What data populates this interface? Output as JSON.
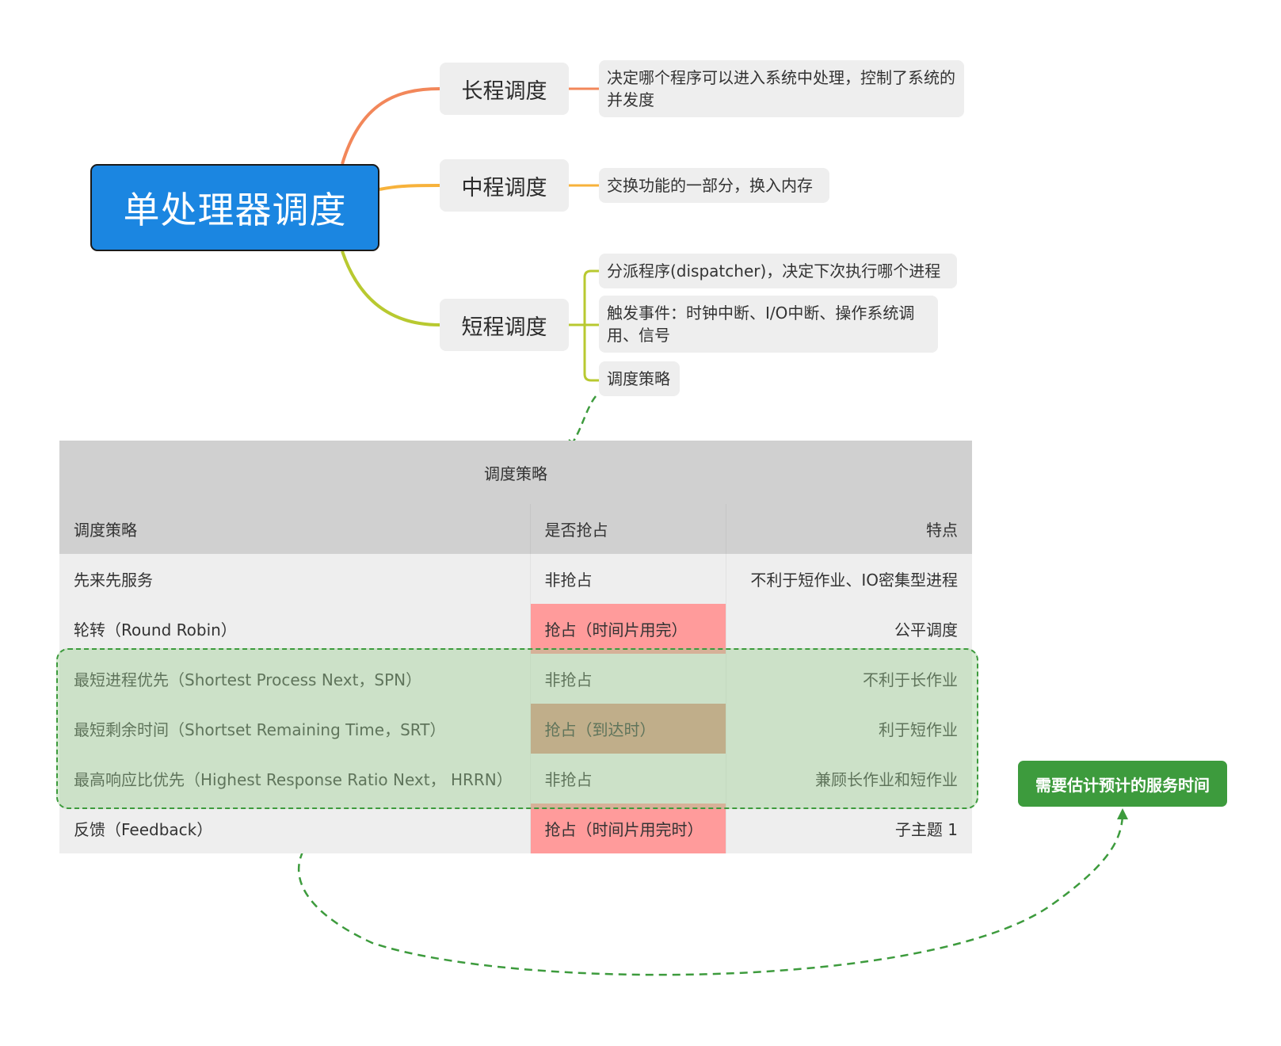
{
  "mindmap": {
    "root": "单处理器调度",
    "branches": [
      {
        "label": "长程调度",
        "color": "#f2875a",
        "leaves": [
          "决定哪个程序可以进入系统中处理，控制了系统的并发度"
        ]
      },
      {
        "label": "中程调度",
        "color": "#f7b23b",
        "leaves": [
          "交换功能的一部分，换入内存"
        ]
      },
      {
        "label": "短程调度",
        "color": "#b8c930",
        "leaves": [
          "分派程序(dispatcher)，决定下次执行哪个进程",
          "触发事件：时钟中断、I/O中断、操作系统调用、信号",
          "调度策略"
        ]
      }
    ]
  },
  "table": {
    "title": "调度策略",
    "headers": [
      "调度策略",
      "是否抢占",
      "特点"
    ],
    "rows": [
      {
        "policy": "先来先服务",
        "preempt": "非抢占",
        "feature": "不利于短作业、IO密集型进程"
      },
      {
        "policy": "轮转（Round Robin）",
        "preempt": "抢占（时间片用完）",
        "feature": "公平调度"
      },
      {
        "policy": "最短进程优先（Shortest Process Next，SPN）",
        "preempt": "非抢占",
        "feature": "不利于长作业"
      },
      {
        "policy": "最短剩余时间（Shortset Remaining Time，SRT）",
        "preempt": "抢占（到达时）",
        "feature": "利于短作业"
      },
      {
        "policy": "最高响应比优先（Highest Response Ratio Next， HRRN）",
        "preempt": "非抢占",
        "feature": "兼顾长作业和短作业"
      },
      {
        "policy": "反馈（Feedback）",
        "preempt": "抢占（时间片用完时）",
        "feature": "子主题 1"
      }
    ]
  },
  "callout": {
    "text": "需要估计预计的服务时间",
    "color": "#3d9b3d"
  },
  "colors": {
    "root_fill": "#1b86e1",
    "node_fill": "#eeeeee",
    "preempt_fill": "#ff9b9b",
    "highlight_fill": "#cde4cd"
  }
}
